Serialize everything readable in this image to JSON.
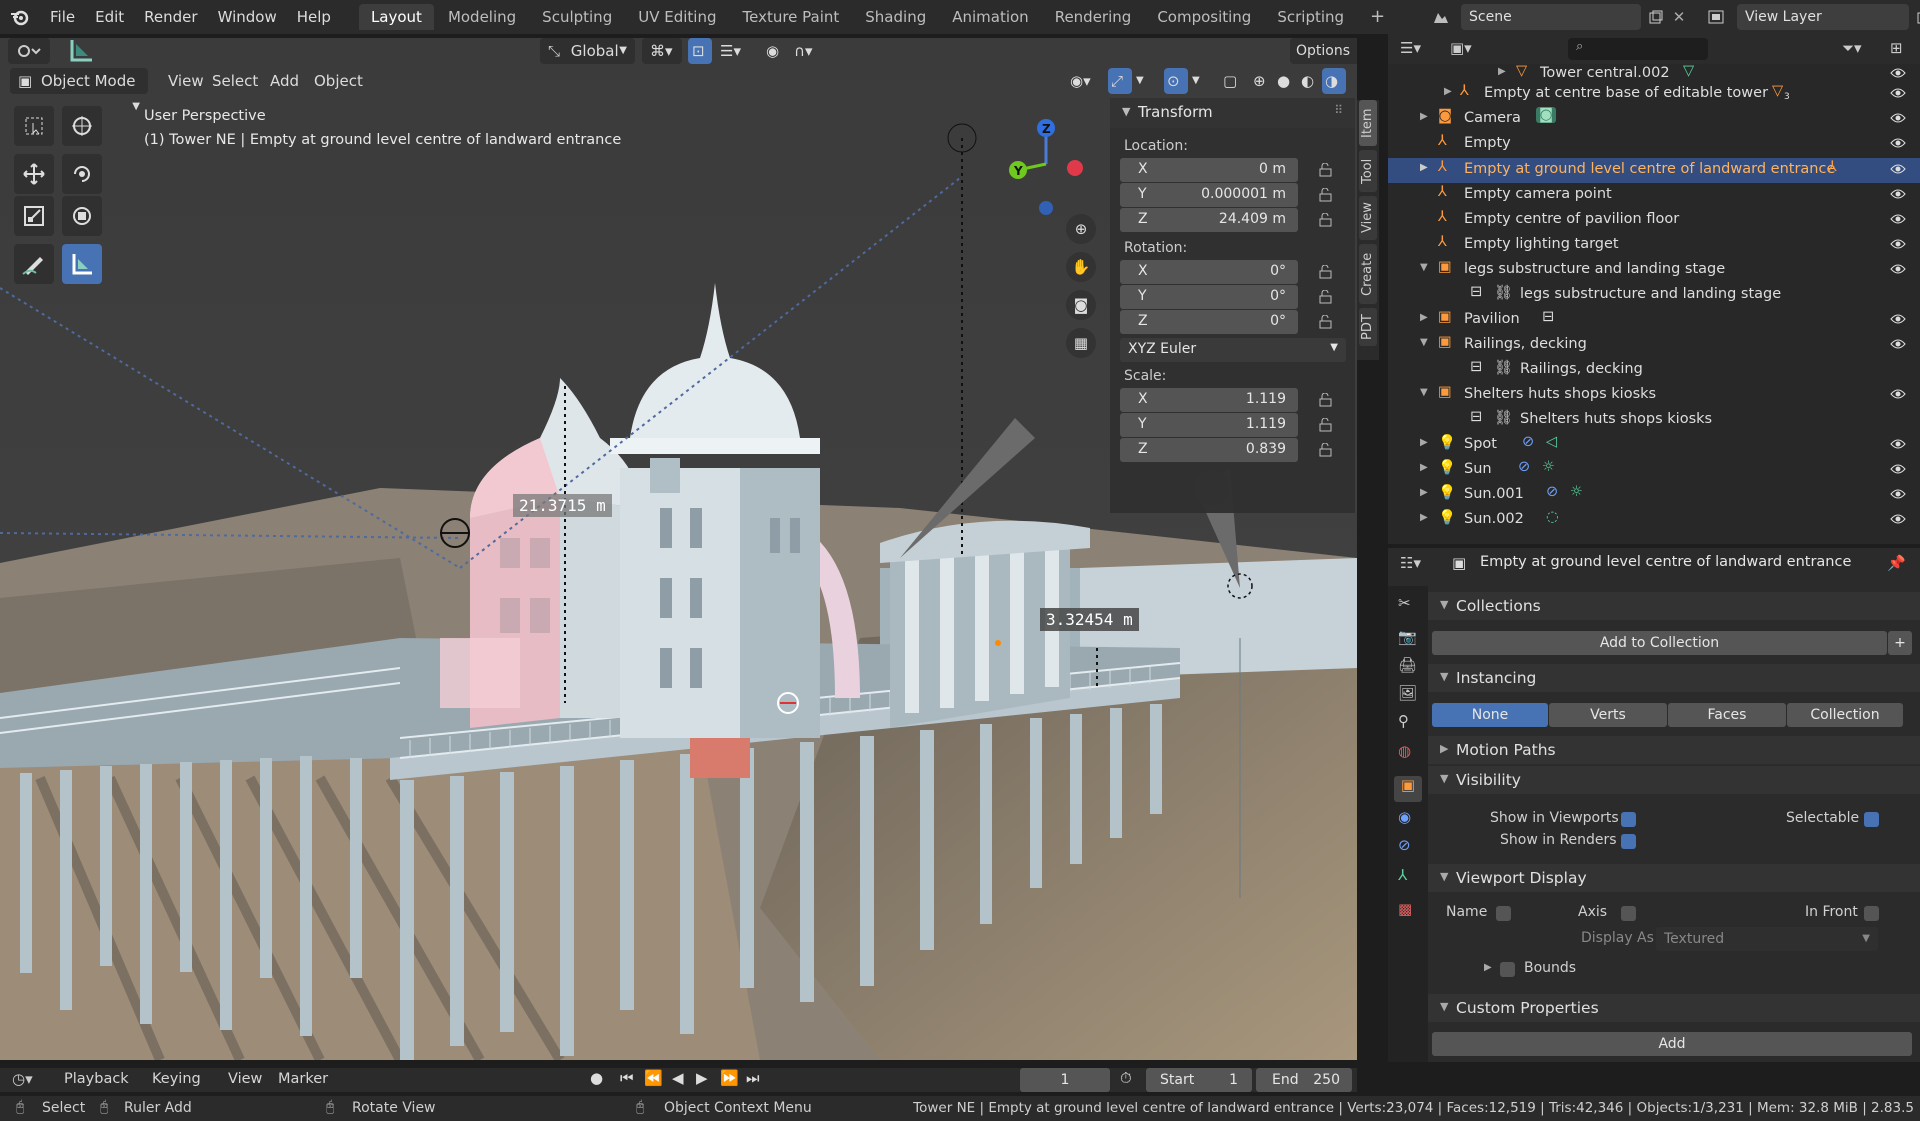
{
  "topbar": {
    "menus": [
      "File",
      "Edit",
      "Render",
      "Window",
      "Help"
    ],
    "workspaces": [
      "Layout",
      "Modeling",
      "Sculpting",
      "UV Editing",
      "Texture Paint",
      "Shading",
      "Animation",
      "Rendering",
      "Compositing",
      "Scripting"
    ],
    "add_tab": "+",
    "scene_label": "Scene",
    "view_layer_label": "View Layer"
  },
  "viewport": {
    "mode": "Object Mode",
    "menus": [
      "View",
      "Select",
      "Add",
      "Object"
    ],
    "orientation": "Global",
    "options_label": "Options",
    "info_title": "User Perspective",
    "info_object": "(1) Tower NE | Empty at ground level centre of landward entrance",
    "measure1": "21.3715 m",
    "measure2": "3.32454 m",
    "gizmo_z": "Z",
    "gizmo_y": "Y"
  },
  "npanel": {
    "title": "Transform",
    "location_label": "Location:",
    "location": [
      {
        "axis": "X",
        "value": "0 m"
      },
      {
        "axis": "Y",
        "value": "0.000001 m"
      },
      {
        "axis": "Z",
        "value": "24.409 m"
      }
    ],
    "rotation_label": "Rotation:",
    "rotation": [
      {
        "axis": "X",
        "value": "0°"
      },
      {
        "axis": "Y",
        "value": "0°"
      },
      {
        "axis": "Z",
        "value": "0°"
      }
    ],
    "rotation_mode": "XYZ Euler",
    "scale_label": "Scale:",
    "scale": [
      {
        "axis": "X",
        "value": "1.119"
      },
      {
        "axis": "Y",
        "value": "1.119"
      },
      {
        "axis": "Z",
        "value": "0.839"
      }
    ],
    "tabs": [
      "Item",
      "Tool",
      "View",
      "Create",
      "PDT"
    ]
  },
  "outliner": {
    "rows": [
      {
        "name": "Tower central.002"
      },
      {
        "name": "Empty at centre base of editable tower"
      },
      {
        "name": "Camera"
      },
      {
        "name": "Empty"
      },
      {
        "name": "Empty at ground level centre of landward entrance"
      },
      {
        "name": "Empty camera point"
      },
      {
        "name": "Empty centre of pavilion floor"
      },
      {
        "name": "Empty lighting target"
      },
      {
        "name": "legs substructure and landing stage"
      },
      {
        "name": "legs substructure and landing stage"
      },
      {
        "name": "Pavilion"
      },
      {
        "name": "Railings, decking"
      },
      {
        "name": "Railings, decking"
      },
      {
        "name": "Shelters huts shops kiosks"
      },
      {
        "name": "Shelters huts shops kiosks"
      },
      {
        "name": "Spot"
      },
      {
        "name": "Sun"
      },
      {
        "name": "Sun.001"
      },
      {
        "name": "Sun.002"
      }
    ],
    "badge_sub": "3"
  },
  "properties": {
    "object_name": "Empty at ground level centre of landward entrance",
    "collections": "Collections",
    "add_to_collection": "Add to Collection",
    "add_plus": "+",
    "instancing": "Instancing",
    "instancing_options": [
      "None",
      "Verts",
      "Faces",
      "Collection"
    ],
    "motion_paths": "Motion Paths",
    "visibility": "Visibility",
    "show_in_viewports": "Show in Viewports",
    "selectable": "Selectable",
    "show_in_renders": "Show in Renders",
    "viewport_display": "Viewport Display",
    "name_label": "Name",
    "axis_label": "Axis",
    "in_front_label": "In Front",
    "display_as_label": "Display As",
    "display_as_value": "Textured",
    "bounds_label": "Bounds",
    "custom_properties": "Custom Properties",
    "add_label": "Add"
  },
  "timeline": {
    "menus": [
      "Playback",
      "Keying",
      "View",
      "Marker"
    ],
    "current_frame": "1",
    "start_label": "Start",
    "start": "1",
    "end_label": "End",
    "end": "250"
  },
  "status": {
    "select": "Select",
    "ruler_add": "Ruler Add",
    "rotate_view": "Rotate View",
    "context_menu": "Object Context Menu",
    "stats": "Tower NE | Empty at ground level centre of landward entrance | Verts:23,074 | Faces:12,519 | Tris:42,346 | Objects:1/3,231 | Mem: 32.8 MiB | 2.83.5"
  }
}
